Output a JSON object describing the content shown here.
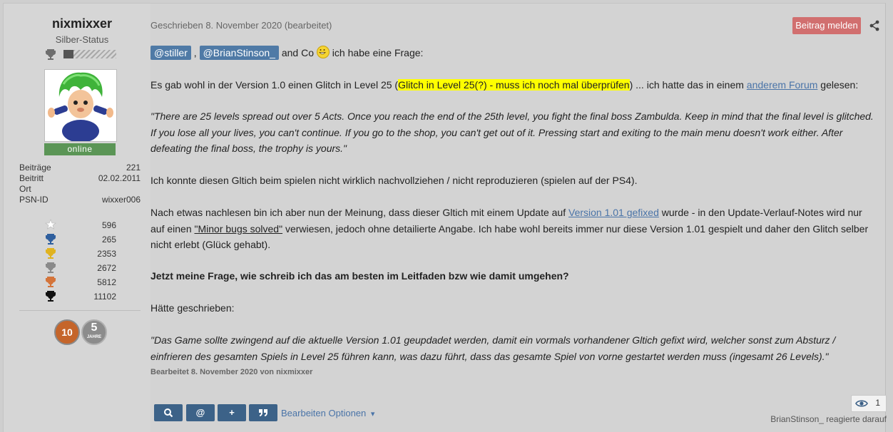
{
  "user": {
    "name": "nixmixxer",
    "rank": "Silber-Status",
    "online_label": "online",
    "stats": [
      {
        "label": "Beiträge",
        "value": "221"
      },
      {
        "label": "Beitritt",
        "value": "02.02.2011"
      },
      {
        "label": "Ort",
        "value": ""
      },
      {
        "label": "PSN-ID",
        "value": "wixxer006"
      }
    ],
    "trophies": [
      {
        "icon": "star-icon",
        "value": "596"
      },
      {
        "icon": "platinum-trophy-icon",
        "value": "265"
      },
      {
        "icon": "gold-trophy-icon",
        "value": "2353"
      },
      {
        "icon": "silver-trophy-icon",
        "value": "2672"
      },
      {
        "icon": "bronze-trophy-icon",
        "value": "5812"
      },
      {
        "icon": "total-trophy-icon",
        "value": "11102"
      }
    ],
    "badges": {
      "years10": "10",
      "years5_num": "5",
      "years5_label": "JAHRE"
    }
  },
  "post": {
    "date_line": "Geschrieben 8. November 2020 (bearbeitet)",
    "report_label": "Beitrag melden",
    "mention1": "@stiller",
    "comma": ",",
    "mention2": "@BrianStinson_",
    "intro_mid": "and Co",
    "intro_end": "ich habe eine Frage:",
    "p2_a": "Es gab wohl in der Version 1.0 einen Glitch in Level 25 (",
    "p2_hl": "Glitch in Level 25(?) - muss ich noch mal überprüfen",
    "p2_b": ") ... ich hatte das in einem",
    "p2_link": "anderem Forum",
    "p2_c": "gelesen:",
    "quote1": "\"There are 25 levels spread out over 5 Acts. Once you reach the end of the 25th level, you fight the final boss Zambulda. Keep in mind that the final level is glitched. If you lose all your lives, you can't continue. If you go to the shop, you can't get out of it. Pressing start and exiting to the main menu doesn't work either. After defeating the final boss, the trophy is yours.\"",
    "p4": "Ich konnte diesen Gltich beim spielen nicht wirklich nachvollziehen / nicht reproduzieren (spielen auf der PS4).",
    "p5_a": "Nach etwas nachlesen bin ich aber nun der Meinung, dass dieser Gltich mit einem Update auf",
    "p5_link": "Version 1.01 gefixed",
    "p5_b": "wurde - in den Update-Verlauf-Notes wird nur auf einen",
    "p5_quote_link": "\"Minor bugs solved\"",
    "p5_c": "verwiesen, jedoch ohne detailierte Angabe. Ich habe wohl bereits immer nur diese Version 1.01 gespielt und daher den Glitch selber nicht erlebt (Glück gehabt).",
    "question": "Jetzt meine Frage, wie schreib ich das am besten im Leitfaden bzw wie damit umgehen?",
    "p7": "Hätte geschrieben:",
    "quote2": "\"Das Game sollte zwingend auf die aktuelle Version 1.01 geupdadet werden, damit ein vormals vorhandener Gltich gefixt wird, welcher sonst zum Absturz / einfrieren des gesamten Spiels in Level 25 führen kann, was dazu führt, dass das gesamte Spiel von vorne gestartet werden muss (ingesamt 26 Levels).\"",
    "edited_note": "Bearbeitet 8. November 2020 von nixmixxer"
  },
  "toolbar": {
    "search_label": "🔍",
    "mention_label": "@",
    "plus_label": "+",
    "quote_label": "❞",
    "edit_options": "Bearbeiten Optionen",
    "chevron": "▾"
  },
  "reactions": {
    "count": "1",
    "text": "BrianStinson_ reagierte darauf"
  }
}
